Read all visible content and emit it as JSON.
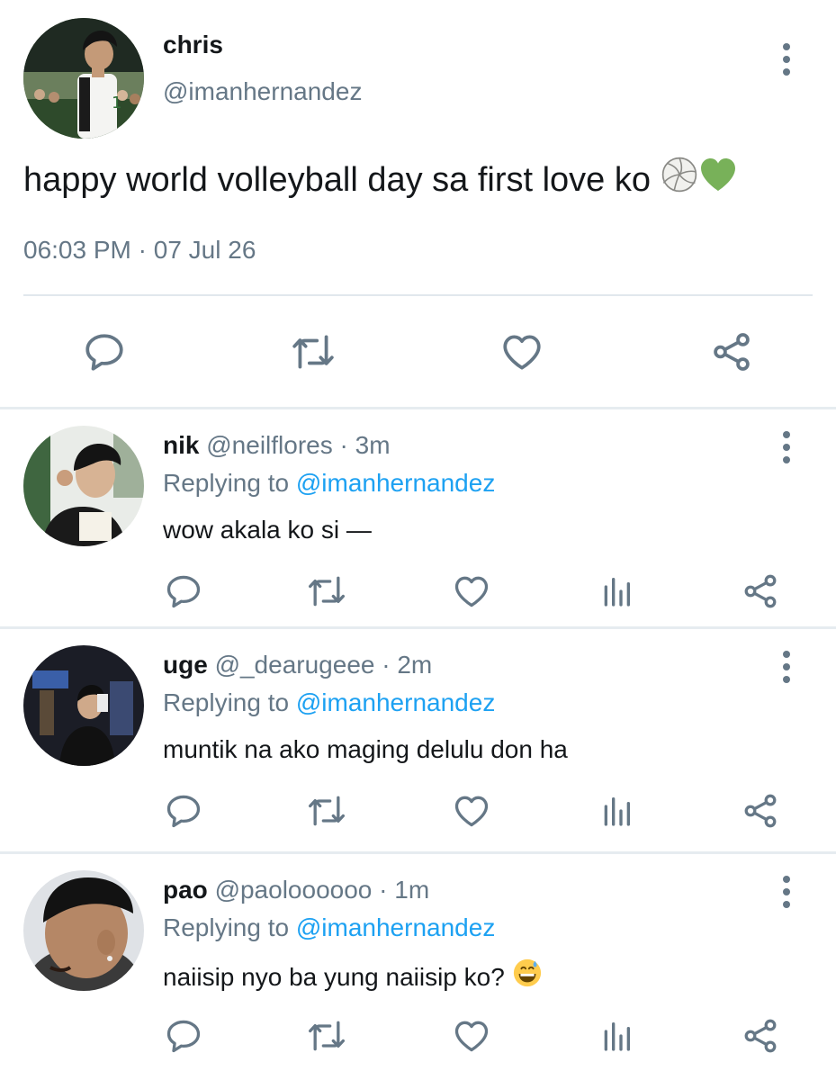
{
  "main_tweet": {
    "display_name": "chris",
    "handle": "@imanhernandez",
    "text": "happy world volleyball day sa first love ko",
    "emojis": [
      "volleyball-emoji",
      "green-heart-emoji"
    ],
    "time": "06:03 PM",
    "separator": "·",
    "date": "07 Jul 26",
    "actions": [
      "reply-icon",
      "retweet-icon",
      "like-icon",
      "share-icon"
    ]
  },
  "replies": [
    {
      "display_name": "nik",
      "handle": "@neilflores",
      "dot": "·",
      "time": "3m",
      "replying_prefix": "Replying to",
      "replying_to": "@imanhernandez",
      "text": "wow akala ko si —"
    },
    {
      "display_name": "uge",
      "handle": "@_dearugeee",
      "dot": "·",
      "time": "2m",
      "replying_prefix": "Replying to",
      "replying_to": "@imanhernandez",
      "text": "muntik na ako maging delulu don ha"
    },
    {
      "display_name": "pao",
      "handle": "@paoloooooo",
      "dot": "·",
      "time": "1m",
      "replying_prefix": "Replying to",
      "replying_to": "@imanhernandez",
      "text": "naiisip nyo ba yung naiisip ko?",
      "emoji": "grinning-sweat-emoji"
    }
  ],
  "colors": {
    "text": "#14171a",
    "secondary": "#657786",
    "accent": "#1da1f2",
    "divider": "#e6ecf0"
  }
}
